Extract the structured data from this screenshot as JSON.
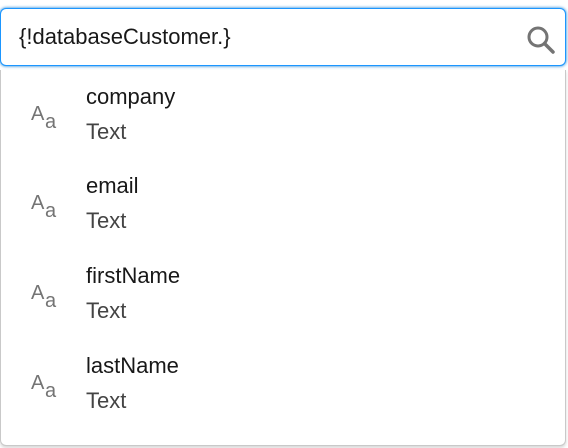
{
  "search": {
    "value": "{!databaseCustomer.}",
    "icon": "search-icon"
  },
  "results": [
    {
      "name": "company",
      "type": "Text",
      "icon": "text-type-icon"
    },
    {
      "name": "email",
      "type": "Text",
      "icon": "text-type-icon"
    },
    {
      "name": "firstName",
      "type": "Text",
      "icon": "text-type-icon"
    },
    {
      "name": "lastName",
      "type": "Text",
      "icon": "text-type-icon"
    }
  ],
  "colors": {
    "focus_border": "#1b96ff",
    "icon_gray": "#747474",
    "text_primary": "#181818"
  }
}
